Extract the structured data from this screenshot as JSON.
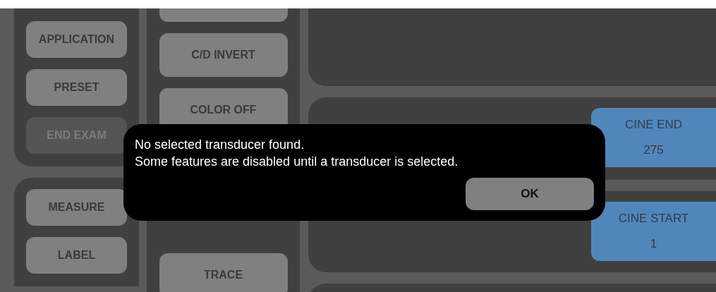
{
  "left_panels": [
    {
      "buttons": [
        {
          "label": "APPLICATION",
          "disabled": false
        },
        {
          "label": "PRESET",
          "disabled": false
        },
        {
          "label": "END EXAM",
          "disabled": true
        }
      ]
    },
    {
      "buttons": [
        {
          "label": "MEASURE",
          "disabled": false
        },
        {
          "label": "LABEL",
          "disabled": false
        }
      ]
    }
  ],
  "center_column": {
    "buttons": [
      {
        "label": "C/D INVERT",
        "disabled": false
      },
      {
        "label": "COLOR OFF",
        "disabled": false
      },
      {
        "label": "TRACE",
        "disabled": false
      }
    ]
  },
  "right_panels": [
    {
      "kind": "empty"
    },
    {
      "kind": "cine",
      "label": "CINE END",
      "value": "275"
    },
    {
      "kind": "cine",
      "label": "CINE START",
      "value": "1"
    },
    {
      "kind": "empty"
    }
  ],
  "dialog": {
    "lines": [
      "No selected transducer found.",
      "Some features are disabled until a transducer is selected."
    ],
    "button": "OK"
  }
}
